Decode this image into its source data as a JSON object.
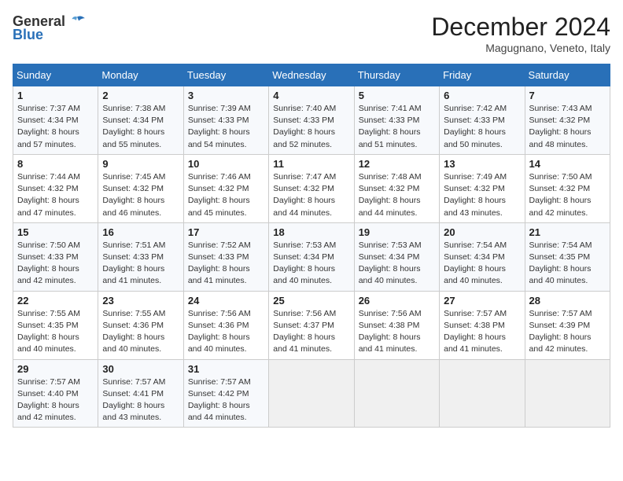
{
  "header": {
    "logo_general": "General",
    "logo_blue": "Blue",
    "title": "December 2024",
    "subtitle": "Magugnano, Veneto, Italy"
  },
  "weekdays": [
    "Sunday",
    "Monday",
    "Tuesday",
    "Wednesday",
    "Thursday",
    "Friday",
    "Saturday"
  ],
  "weeks": [
    [
      {
        "day": "1",
        "sunrise": "Sunrise: 7:37 AM",
        "sunset": "Sunset: 4:34 PM",
        "daylight": "Daylight: 8 hours and 57 minutes."
      },
      {
        "day": "2",
        "sunrise": "Sunrise: 7:38 AM",
        "sunset": "Sunset: 4:34 PM",
        "daylight": "Daylight: 8 hours and 55 minutes."
      },
      {
        "day": "3",
        "sunrise": "Sunrise: 7:39 AM",
        "sunset": "Sunset: 4:33 PM",
        "daylight": "Daylight: 8 hours and 54 minutes."
      },
      {
        "day": "4",
        "sunrise": "Sunrise: 7:40 AM",
        "sunset": "Sunset: 4:33 PM",
        "daylight": "Daylight: 8 hours and 52 minutes."
      },
      {
        "day": "5",
        "sunrise": "Sunrise: 7:41 AM",
        "sunset": "Sunset: 4:33 PM",
        "daylight": "Daylight: 8 hours and 51 minutes."
      },
      {
        "day": "6",
        "sunrise": "Sunrise: 7:42 AM",
        "sunset": "Sunset: 4:33 PM",
        "daylight": "Daylight: 8 hours and 50 minutes."
      },
      {
        "day": "7",
        "sunrise": "Sunrise: 7:43 AM",
        "sunset": "Sunset: 4:32 PM",
        "daylight": "Daylight: 8 hours and 48 minutes."
      }
    ],
    [
      {
        "day": "8",
        "sunrise": "Sunrise: 7:44 AM",
        "sunset": "Sunset: 4:32 PM",
        "daylight": "Daylight: 8 hours and 47 minutes."
      },
      {
        "day": "9",
        "sunrise": "Sunrise: 7:45 AM",
        "sunset": "Sunset: 4:32 PM",
        "daylight": "Daylight: 8 hours and 46 minutes."
      },
      {
        "day": "10",
        "sunrise": "Sunrise: 7:46 AM",
        "sunset": "Sunset: 4:32 PM",
        "daylight": "Daylight: 8 hours and 45 minutes."
      },
      {
        "day": "11",
        "sunrise": "Sunrise: 7:47 AM",
        "sunset": "Sunset: 4:32 PM",
        "daylight": "Daylight: 8 hours and 44 minutes."
      },
      {
        "day": "12",
        "sunrise": "Sunrise: 7:48 AM",
        "sunset": "Sunset: 4:32 PM",
        "daylight": "Daylight: 8 hours and 44 minutes."
      },
      {
        "day": "13",
        "sunrise": "Sunrise: 7:49 AM",
        "sunset": "Sunset: 4:32 PM",
        "daylight": "Daylight: 8 hours and 43 minutes."
      },
      {
        "day": "14",
        "sunrise": "Sunrise: 7:50 AM",
        "sunset": "Sunset: 4:32 PM",
        "daylight": "Daylight: 8 hours and 42 minutes."
      }
    ],
    [
      {
        "day": "15",
        "sunrise": "Sunrise: 7:50 AM",
        "sunset": "Sunset: 4:33 PM",
        "daylight": "Daylight: 8 hours and 42 minutes."
      },
      {
        "day": "16",
        "sunrise": "Sunrise: 7:51 AM",
        "sunset": "Sunset: 4:33 PM",
        "daylight": "Daylight: 8 hours and 41 minutes."
      },
      {
        "day": "17",
        "sunrise": "Sunrise: 7:52 AM",
        "sunset": "Sunset: 4:33 PM",
        "daylight": "Daylight: 8 hours and 41 minutes."
      },
      {
        "day": "18",
        "sunrise": "Sunrise: 7:53 AM",
        "sunset": "Sunset: 4:34 PM",
        "daylight": "Daylight: 8 hours and 40 minutes."
      },
      {
        "day": "19",
        "sunrise": "Sunrise: 7:53 AM",
        "sunset": "Sunset: 4:34 PM",
        "daylight": "Daylight: 8 hours and 40 minutes."
      },
      {
        "day": "20",
        "sunrise": "Sunrise: 7:54 AM",
        "sunset": "Sunset: 4:34 PM",
        "daylight": "Daylight: 8 hours and 40 minutes."
      },
      {
        "day": "21",
        "sunrise": "Sunrise: 7:54 AM",
        "sunset": "Sunset: 4:35 PM",
        "daylight": "Daylight: 8 hours and 40 minutes."
      }
    ],
    [
      {
        "day": "22",
        "sunrise": "Sunrise: 7:55 AM",
        "sunset": "Sunset: 4:35 PM",
        "daylight": "Daylight: 8 hours and 40 minutes."
      },
      {
        "day": "23",
        "sunrise": "Sunrise: 7:55 AM",
        "sunset": "Sunset: 4:36 PM",
        "daylight": "Daylight: 8 hours and 40 minutes."
      },
      {
        "day": "24",
        "sunrise": "Sunrise: 7:56 AM",
        "sunset": "Sunset: 4:36 PM",
        "daylight": "Daylight: 8 hours and 40 minutes."
      },
      {
        "day": "25",
        "sunrise": "Sunrise: 7:56 AM",
        "sunset": "Sunset: 4:37 PM",
        "daylight": "Daylight: 8 hours and 41 minutes."
      },
      {
        "day": "26",
        "sunrise": "Sunrise: 7:56 AM",
        "sunset": "Sunset: 4:38 PM",
        "daylight": "Daylight: 8 hours and 41 minutes."
      },
      {
        "day": "27",
        "sunrise": "Sunrise: 7:57 AM",
        "sunset": "Sunset: 4:38 PM",
        "daylight": "Daylight: 8 hours and 41 minutes."
      },
      {
        "day": "28",
        "sunrise": "Sunrise: 7:57 AM",
        "sunset": "Sunset: 4:39 PM",
        "daylight": "Daylight: 8 hours and 42 minutes."
      }
    ],
    [
      {
        "day": "29",
        "sunrise": "Sunrise: 7:57 AM",
        "sunset": "Sunset: 4:40 PM",
        "daylight": "Daylight: 8 hours and 42 minutes."
      },
      {
        "day": "30",
        "sunrise": "Sunrise: 7:57 AM",
        "sunset": "Sunset: 4:41 PM",
        "daylight": "Daylight: 8 hours and 43 minutes."
      },
      {
        "day": "31",
        "sunrise": "Sunrise: 7:57 AM",
        "sunset": "Sunset: 4:42 PM",
        "daylight": "Daylight: 8 hours and 44 minutes."
      },
      null,
      null,
      null,
      null
    ]
  ]
}
